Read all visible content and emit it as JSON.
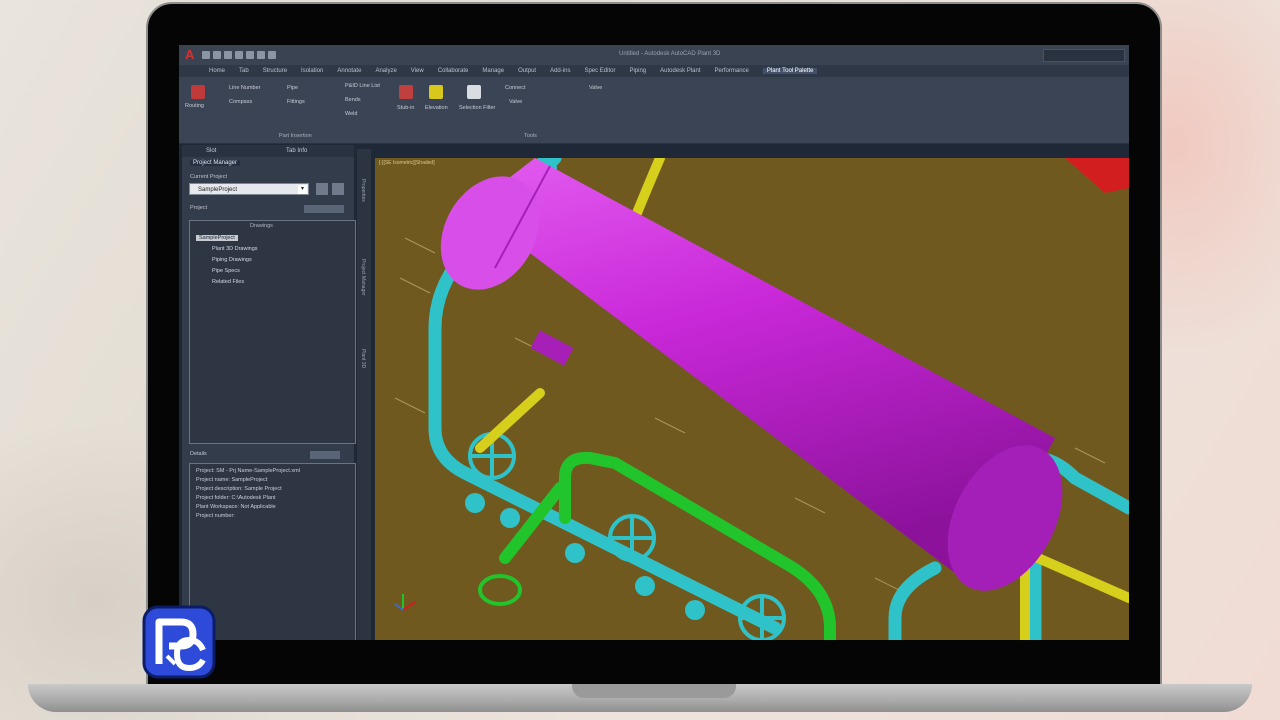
{
  "app": {
    "logo": "A",
    "document_title": "Untitled - Autodesk AutoCAD Plant 3D",
    "quick_access": [
      "new-icon",
      "open-icon",
      "save-icon",
      "saveas-icon",
      "print-icon",
      "undo-icon",
      "redo-icon"
    ]
  },
  "ribbon": {
    "tabs": [
      "Home",
      "Tab",
      "Structure",
      "Isolation",
      "Annotate",
      "Analyze",
      "View",
      "Collaborate",
      "Manage",
      "Output",
      "Add-ins",
      "Spec Editor",
      "Piping",
      "Autodesk Plant",
      "Performance",
      "Plant Tool Palette"
    ],
    "active_tab": "Plant Tool Palette",
    "buttons": [
      "Routing",
      "Line Number",
      "Compass",
      "Pipe",
      "Fittings",
      "P&ID Line List",
      "Bends",
      "Weld",
      "Stub-in",
      "Elevation",
      "Selection Filter",
      "Connect",
      "Valve",
      "Valve"
    ],
    "panel_labels": [
      "Part Insertion",
      "Tools"
    ]
  },
  "palette": {
    "header_tabs": [
      "Slot",
      "Tab Info"
    ],
    "title": "Project Manager",
    "current_project_label": "Current Project",
    "project_dropdown": "SampleProject",
    "project_label": "Project",
    "tree_header": "Drawings",
    "tree": [
      {
        "label": "SampleProject",
        "selected": true
      },
      {
        "label": "Plant 3D Drawings",
        "selected": false
      },
      {
        "label": "Piping Drawings",
        "selected": false
      },
      {
        "label": "Pipe Specs",
        "selected": false
      },
      {
        "label": "Related Files",
        "selected": false
      }
    ],
    "details_label": "Details",
    "details_lines": [
      "Project: SM - Prj Name-SampleProject.xml",
      "Project name: SampleProject",
      "Project description: Sample Project",
      "Project folder: C:\\Autodesk Plant",
      "Plant Workspace: Not Applicable",
      "Project number:"
    ],
    "strip_labels": [
      "Properties",
      "Project Manager",
      "Plant 3D"
    ]
  },
  "viewport": {
    "label": "[-][SE Isometric][Shaded]",
    "background": "#70591e",
    "vessel_color": "#c928d8",
    "pipe_colors": [
      "#2fc3c9",
      "#21c42a",
      "#d6cf1c"
    ]
  },
  "colors": {
    "ui_dark": "#1f2836",
    "ribbon": "#3b4454",
    "laptop_bezel": "#050505"
  }
}
